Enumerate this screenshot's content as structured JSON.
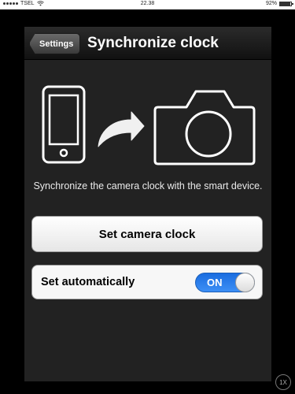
{
  "status_bar": {
    "carrier": "TSEL",
    "time": "22.38",
    "battery": "92%",
    "battery_level": 0.92,
    "wifi_icon": "wifi-icon",
    "battery_icon": "battery-icon"
  },
  "nav": {
    "back_label": "Settings",
    "title": "Synchronize clock"
  },
  "illustration": {
    "phone_icon": "smartphone-icon",
    "arrow_icon": "curved-arrow-right-icon",
    "camera_icon": "camera-icon"
  },
  "description": "Synchronize the camera clock with the smart device.",
  "set_clock_button": "Set camera clock",
  "auto_setting": {
    "label": "Set automatically",
    "toggle_label": "ON",
    "enabled": true
  },
  "zoom_badge": "1X",
  "colors": {
    "background": "#000000",
    "panel": "#222222",
    "toggle_on": "#2a7de8"
  }
}
